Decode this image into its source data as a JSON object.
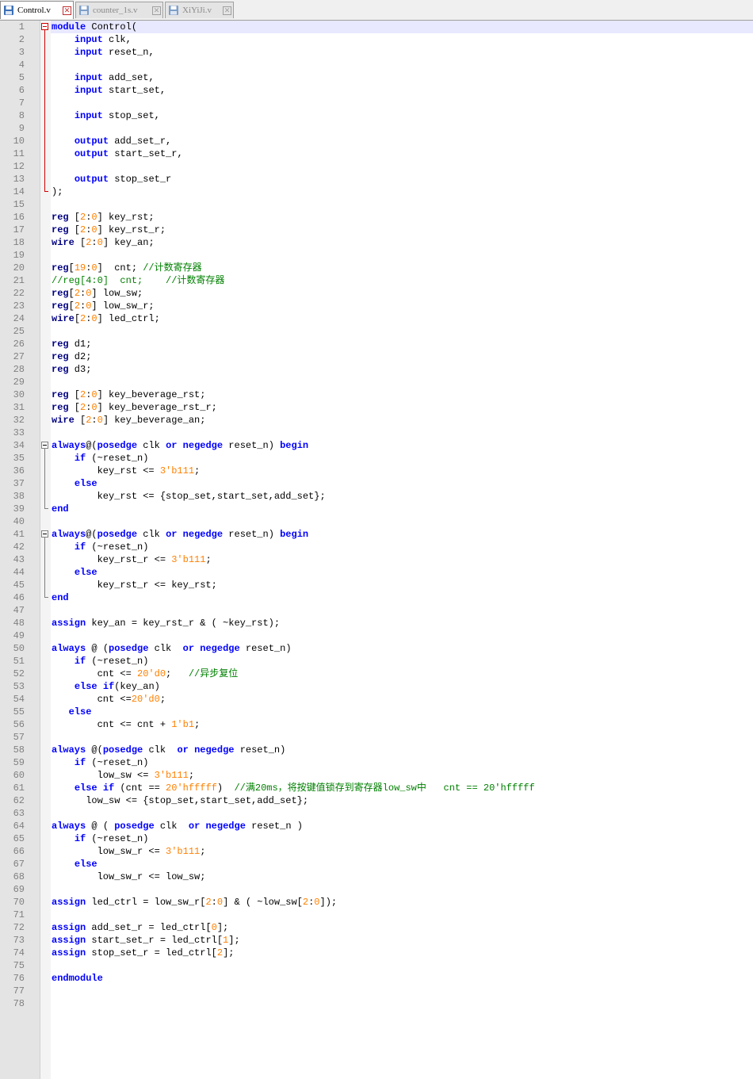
{
  "tabs": [
    {
      "label": "Control.v",
      "active": true,
      "icon": "save-disk-icon"
    },
    {
      "label": "counter_1s.v",
      "active": false,
      "icon": "save-disk-icon"
    },
    {
      "label": "XiYiJi.v",
      "active": false,
      "icon": "save-disk-icon"
    }
  ],
  "colors": {
    "keyword": "#0000ff",
    "type": "#000080",
    "number": "#ff8000",
    "comment": "#008000",
    "current_line": "#e8e8ff",
    "fold_active": "#d00000"
  },
  "editor": {
    "current_line": 1,
    "lines": [
      [
        [
          "kw",
          "module"
        ],
        [
          "t",
          " Control("
        ]
      ],
      [
        [
          "t",
          "    "
        ],
        [
          "kw",
          "input"
        ],
        [
          "t",
          " clk,"
        ]
      ],
      [
        [
          "t",
          "    "
        ],
        [
          "kw",
          "input"
        ],
        [
          "t",
          " reset_n,"
        ]
      ],
      [],
      [
        [
          "t",
          "    "
        ],
        [
          "kw",
          "input"
        ],
        [
          "t",
          " add_set,"
        ]
      ],
      [
        [
          "t",
          "    "
        ],
        [
          "kw",
          "input"
        ],
        [
          "t",
          " start_set,"
        ]
      ],
      [],
      [
        [
          "t",
          "    "
        ],
        [
          "kw",
          "input"
        ],
        [
          "t",
          " stop_set,"
        ]
      ],
      [],
      [
        [
          "t",
          "    "
        ],
        [
          "kw",
          "output"
        ],
        [
          "t",
          " add_set_r,"
        ]
      ],
      [
        [
          "t",
          "    "
        ],
        [
          "kw",
          "output"
        ],
        [
          "t",
          " start_set_r,"
        ]
      ],
      [],
      [
        [
          "t",
          "    "
        ],
        [
          "kw",
          "output"
        ],
        [
          "t",
          " stop_set_r"
        ]
      ],
      [
        [
          "t",
          ");"
        ]
      ],
      [],
      [
        [
          "ty",
          "reg"
        ],
        [
          "t",
          " ["
        ],
        [
          "nm",
          "2"
        ],
        [
          "t",
          ":"
        ],
        [
          "nm",
          "0"
        ],
        [
          "t",
          "] key_rst;"
        ]
      ],
      [
        [
          "ty",
          "reg"
        ],
        [
          "t",
          " ["
        ],
        [
          "nm",
          "2"
        ],
        [
          "t",
          ":"
        ],
        [
          "nm",
          "0"
        ],
        [
          "t",
          "] key_rst_r;"
        ]
      ],
      [
        [
          "ty",
          "wire"
        ],
        [
          "t",
          " ["
        ],
        [
          "nm",
          "2"
        ],
        [
          "t",
          ":"
        ],
        [
          "nm",
          "0"
        ],
        [
          "t",
          "] key_an;"
        ]
      ],
      [],
      [
        [
          "ty",
          "reg"
        ],
        [
          "t",
          "["
        ],
        [
          "nm",
          "19"
        ],
        [
          "t",
          ":"
        ],
        [
          "nm",
          "0"
        ],
        [
          "t",
          "]  cnt; "
        ],
        [
          "cm",
          "//计数寄存器"
        ]
      ],
      [
        [
          "cm",
          "//reg[4:0]  cnt;    //计数寄存器"
        ]
      ],
      [
        [
          "ty",
          "reg"
        ],
        [
          "t",
          "["
        ],
        [
          "nm",
          "2"
        ],
        [
          "t",
          ":"
        ],
        [
          "nm",
          "0"
        ],
        [
          "t",
          "] low_sw;"
        ]
      ],
      [
        [
          "ty",
          "reg"
        ],
        [
          "t",
          "["
        ],
        [
          "nm",
          "2"
        ],
        [
          "t",
          ":"
        ],
        [
          "nm",
          "0"
        ],
        [
          "t",
          "] low_sw_r;"
        ]
      ],
      [
        [
          "ty",
          "wire"
        ],
        [
          "t",
          "["
        ],
        [
          "nm",
          "2"
        ],
        [
          "t",
          ":"
        ],
        [
          "nm",
          "0"
        ],
        [
          "t",
          "] led_ctrl;"
        ]
      ],
      [],
      [
        [
          "ty",
          "reg"
        ],
        [
          "t",
          " d1;"
        ]
      ],
      [
        [
          "ty",
          "reg"
        ],
        [
          "t",
          " d2;"
        ]
      ],
      [
        [
          "ty",
          "reg"
        ],
        [
          "t",
          " d3;"
        ]
      ],
      [],
      [
        [
          "ty",
          "reg"
        ],
        [
          "t",
          " ["
        ],
        [
          "nm",
          "2"
        ],
        [
          "t",
          ":"
        ],
        [
          "nm",
          "0"
        ],
        [
          "t",
          "] key_beverage_rst;"
        ]
      ],
      [
        [
          "ty",
          "reg"
        ],
        [
          "t",
          " ["
        ],
        [
          "nm",
          "2"
        ],
        [
          "t",
          ":"
        ],
        [
          "nm",
          "0"
        ],
        [
          "t",
          "] key_beverage_rst_r;"
        ]
      ],
      [
        [
          "ty",
          "wire"
        ],
        [
          "t",
          " ["
        ],
        [
          "nm",
          "2"
        ],
        [
          "t",
          ":"
        ],
        [
          "nm",
          "0"
        ],
        [
          "t",
          "] key_beverage_an;"
        ]
      ],
      [],
      [
        [
          "kw",
          "always"
        ],
        [
          "t",
          "@("
        ],
        [
          "kw",
          "posedge"
        ],
        [
          "t",
          " clk "
        ],
        [
          "kw",
          "or"
        ],
        [
          "t",
          " "
        ],
        [
          "kw",
          "negedge"
        ],
        [
          "t",
          " reset_n) "
        ],
        [
          "kw",
          "begin"
        ]
      ],
      [
        [
          "t",
          "    "
        ],
        [
          "kw",
          "if"
        ],
        [
          "t",
          " (~reset_n)"
        ]
      ],
      [
        [
          "t",
          "        key_rst <= "
        ],
        [
          "nm",
          "3'b111"
        ],
        [
          "t",
          ";"
        ]
      ],
      [
        [
          "t",
          "    "
        ],
        [
          "kw",
          "else"
        ]
      ],
      [
        [
          "t",
          "        key_rst <= {stop_set,start_set,add_set};"
        ]
      ],
      [
        [
          "kw",
          "end"
        ]
      ],
      [],
      [
        [
          "kw",
          "always"
        ],
        [
          "t",
          "@("
        ],
        [
          "kw",
          "posedge"
        ],
        [
          "t",
          " clk "
        ],
        [
          "kw",
          "or"
        ],
        [
          "t",
          " "
        ],
        [
          "kw",
          "negedge"
        ],
        [
          "t",
          " reset_n) "
        ],
        [
          "kw",
          "begin"
        ]
      ],
      [
        [
          "t",
          "    "
        ],
        [
          "kw",
          "if"
        ],
        [
          "t",
          " (~reset_n)"
        ]
      ],
      [
        [
          "t",
          "        key_rst_r <= "
        ],
        [
          "nm",
          "3'b111"
        ],
        [
          "t",
          ";"
        ]
      ],
      [
        [
          "t",
          "    "
        ],
        [
          "kw",
          "else"
        ]
      ],
      [
        [
          "t",
          "        key_rst_r <= key_rst;"
        ]
      ],
      [
        [
          "kw",
          "end"
        ]
      ],
      [],
      [
        [
          "kw",
          "assign"
        ],
        [
          "t",
          " key_an = key_rst_r & ( ~key_rst);"
        ]
      ],
      [],
      [
        [
          "kw",
          "always"
        ],
        [
          "t",
          " @ ("
        ],
        [
          "kw",
          "posedge"
        ],
        [
          "t",
          " clk  "
        ],
        [
          "kw",
          "or"
        ],
        [
          "t",
          " "
        ],
        [
          "kw",
          "negedge"
        ],
        [
          "t",
          " reset_n)"
        ]
      ],
      [
        [
          "t",
          "    "
        ],
        [
          "kw",
          "if"
        ],
        [
          "t",
          " (~reset_n)"
        ]
      ],
      [
        [
          "t",
          "        cnt <= "
        ],
        [
          "nm",
          "20'd0"
        ],
        [
          "t",
          ";   "
        ],
        [
          "cm",
          "//异步复位"
        ]
      ],
      [
        [
          "t",
          "    "
        ],
        [
          "kw",
          "else"
        ],
        [
          "t",
          " "
        ],
        [
          "kw",
          "if"
        ],
        [
          "t",
          "(key_an)"
        ]
      ],
      [
        [
          "t",
          "        cnt <="
        ],
        [
          "nm",
          "20'd0"
        ],
        [
          "t",
          ";"
        ]
      ],
      [
        [
          "t",
          "   "
        ],
        [
          "kw",
          "else"
        ]
      ],
      [
        [
          "t",
          "        cnt <= cnt + "
        ],
        [
          "nm",
          "1'b1"
        ],
        [
          "t",
          ";"
        ]
      ],
      [],
      [
        [
          "kw",
          "always"
        ],
        [
          "t",
          " @("
        ],
        [
          "kw",
          "posedge"
        ],
        [
          "t",
          " clk  "
        ],
        [
          "kw",
          "or"
        ],
        [
          "t",
          " "
        ],
        [
          "kw",
          "negedge"
        ],
        [
          "t",
          " reset_n)"
        ]
      ],
      [
        [
          "t",
          "    "
        ],
        [
          "kw",
          "if"
        ],
        [
          "t",
          " (~reset_n)"
        ]
      ],
      [
        [
          "t",
          "        low_sw <= "
        ],
        [
          "nm",
          "3'b111"
        ],
        [
          "t",
          ";"
        ]
      ],
      [
        [
          "t",
          "    "
        ],
        [
          "kw",
          "else"
        ],
        [
          "t",
          " "
        ],
        [
          "kw",
          "if"
        ],
        [
          "t",
          " (cnt == "
        ],
        [
          "nm",
          "20'hfffff"
        ],
        [
          "t",
          ")  "
        ],
        [
          "cm",
          "//满20ms，将按键值锁存到寄存器low_sw中   cnt == 20'hfffff"
        ]
      ],
      [
        [
          "t",
          "      low_sw <= {stop_set,start_set,add_set};"
        ]
      ],
      [],
      [
        [
          "kw",
          "always"
        ],
        [
          "t",
          " @ ( "
        ],
        [
          "kw",
          "posedge"
        ],
        [
          "t",
          " clk  "
        ],
        [
          "kw",
          "or"
        ],
        [
          "t",
          " "
        ],
        [
          "kw",
          "negedge"
        ],
        [
          "t",
          " reset_n )"
        ]
      ],
      [
        [
          "t",
          "    "
        ],
        [
          "kw",
          "if"
        ],
        [
          "t",
          " (~reset_n)"
        ]
      ],
      [
        [
          "t",
          "        low_sw_r <= "
        ],
        [
          "nm",
          "3'b111"
        ],
        [
          "t",
          ";"
        ]
      ],
      [
        [
          "t",
          "    "
        ],
        [
          "kw",
          "else"
        ]
      ],
      [
        [
          "t",
          "        low_sw_r <= low_sw;"
        ]
      ],
      [],
      [
        [
          "kw",
          "assign"
        ],
        [
          "t",
          " led_ctrl = low_sw_r["
        ],
        [
          "nm",
          "2"
        ],
        [
          "t",
          ":"
        ],
        [
          "nm",
          "0"
        ],
        [
          "t",
          "] & ( ~low_sw["
        ],
        [
          "nm",
          "2"
        ],
        [
          "t",
          ":"
        ],
        [
          "nm",
          "0"
        ],
        [
          "t",
          "]);"
        ]
      ],
      [],
      [
        [
          "kw",
          "assign"
        ],
        [
          "t",
          " add_set_r = led_ctrl["
        ],
        [
          "nm",
          "0"
        ],
        [
          "t",
          "];"
        ]
      ],
      [
        [
          "kw",
          "assign"
        ],
        [
          "t",
          " start_set_r = led_ctrl["
        ],
        [
          "nm",
          "1"
        ],
        [
          "t",
          "];"
        ]
      ],
      [
        [
          "kw",
          "assign"
        ],
        [
          "t",
          " stop_set_r = led_ctrl["
        ],
        [
          "nm",
          "2"
        ],
        [
          "t",
          "];"
        ]
      ],
      [],
      [
        [
          "kw",
          "endmodule"
        ]
      ],
      [],
      []
    ],
    "folds": [
      {
        "start": 1,
        "end": 14,
        "active": true
      },
      {
        "start": 34,
        "end": 39,
        "active": false
      },
      {
        "start": 41,
        "end": 46,
        "active": false
      }
    ]
  }
}
